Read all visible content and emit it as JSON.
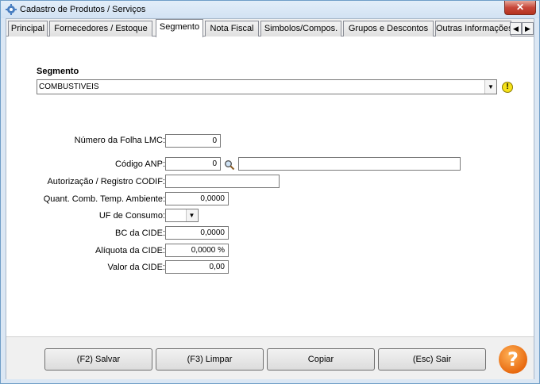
{
  "window": {
    "title": "Cadastro de Produtos / Serviços",
    "close_label": "✕"
  },
  "tabs": [
    {
      "label": "Principal"
    },
    {
      "label": "Fornecedores / Estoque"
    },
    {
      "label": "Segmento",
      "active": true
    },
    {
      "label": "Nota Fiscal"
    },
    {
      "label": "Simbolos/Compos."
    },
    {
      "label": "Grupos e Descontos"
    },
    {
      "label": "Outras Informações"
    }
  ],
  "tab_scroll": {
    "left": "◀",
    "right": "▶"
  },
  "segmento": {
    "label": "Segmento",
    "value": "COMBUSTIVEIS",
    "dropdown_glyph": "▼",
    "warning_glyph": "!"
  },
  "form": {
    "folha_lmc": {
      "label": "Número da Folha LMC:",
      "value": "0"
    },
    "codigo_anp": {
      "label": "Código ANP:",
      "value": "0",
      "description": ""
    },
    "codif": {
      "label": "Autorização / Registro CODIF:",
      "value": ""
    },
    "quant_comb": {
      "label": "Quant. Comb. Temp. Ambiente:",
      "value": "0,0000"
    },
    "uf_consumo": {
      "label": "UF de Consumo:",
      "value": "",
      "dropdown_glyph": "▼"
    },
    "bc_cide": {
      "label": "BC da CIDE:",
      "value": "0,0000"
    },
    "aliquota_cide": {
      "label": "Alíquota da CIDE:",
      "value": "0,0000 %"
    },
    "valor_cide": {
      "label": "Valor da CIDE:",
      "value": "0,00"
    }
  },
  "buttons": {
    "salvar": "(F2) Salvar",
    "limpar": "(F3) Limpar",
    "copiar": "Copiar",
    "sair": "(Esc) Sair"
  },
  "help_glyph": "?",
  "colors": {
    "window_border": "#6f9ec7",
    "help_orange": "#e86a10",
    "warning_yellow": "#f6e21a"
  }
}
